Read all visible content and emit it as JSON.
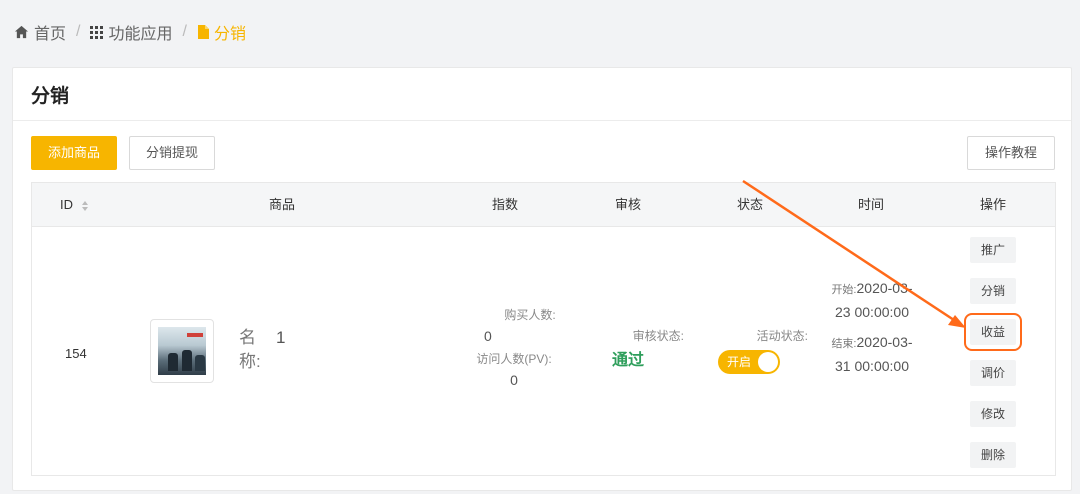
{
  "breadcrumb": {
    "home": "首页",
    "section": "功能应用",
    "current": "分销"
  },
  "card": {
    "title": "分销"
  },
  "toolbar": {
    "add_product": "添加商品",
    "withdraw": "分销提现",
    "tutorial": "操作教程"
  },
  "table": {
    "headers": [
      "ID",
      "商品",
      "指数",
      "审核",
      "状态",
      "时间",
      "操作"
    ],
    "row": {
      "id": "154",
      "name_label": "名称:",
      "name_value": "1",
      "buyers_label": "购买人数:",
      "buyers_value": "0",
      "pv_label": "访问人数(PV):",
      "pv_value": "0",
      "audit_label": "审核状态:",
      "audit_value": "通过",
      "status_label": "活动状态:",
      "toggle_label": "开启",
      "start_label": "开始:",
      "start_value": "2020-03-23 00:00:00",
      "end_label": "结束:",
      "end_value": "2020-03-31 00:00:00",
      "ops": [
        "推广",
        "分销",
        "收益",
        "调价",
        "修改",
        "删除"
      ]
    }
  },
  "colors": {
    "accent": "#f7b500",
    "success": "#2e9e5b",
    "annotation": "#ff6a1a"
  },
  "icons": [
    "home-icon",
    "grid-icon",
    "file-icon",
    "sort-icon"
  ]
}
